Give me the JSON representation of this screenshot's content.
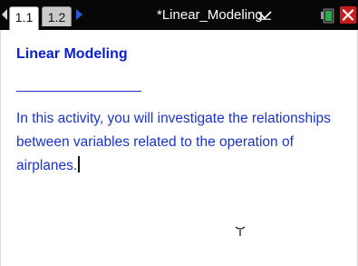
{
  "tabs": [
    {
      "label": "1.1",
      "active": true
    },
    {
      "label": "1.2",
      "active": false
    }
  ],
  "document": {
    "title": "*Linear_Modeling"
  },
  "icons": {
    "nav_left": "arrow-left-icon",
    "nav_right": "arrow-right-icon",
    "menu": "chevron-down-icon",
    "battery": "battery-icon",
    "close": "close-icon"
  },
  "content": {
    "heading": "Linear Modeling",
    "paragraph": "In this activity, you will investigate the relationships between variables related to the operation of airplanes."
  },
  "colors": {
    "topbar": "#070707",
    "text_blue": "#1a32cf",
    "heading_blue": "#0a1fd0",
    "nav_arrow": "#2a5ad8",
    "close_red": "#c81d1d"
  }
}
